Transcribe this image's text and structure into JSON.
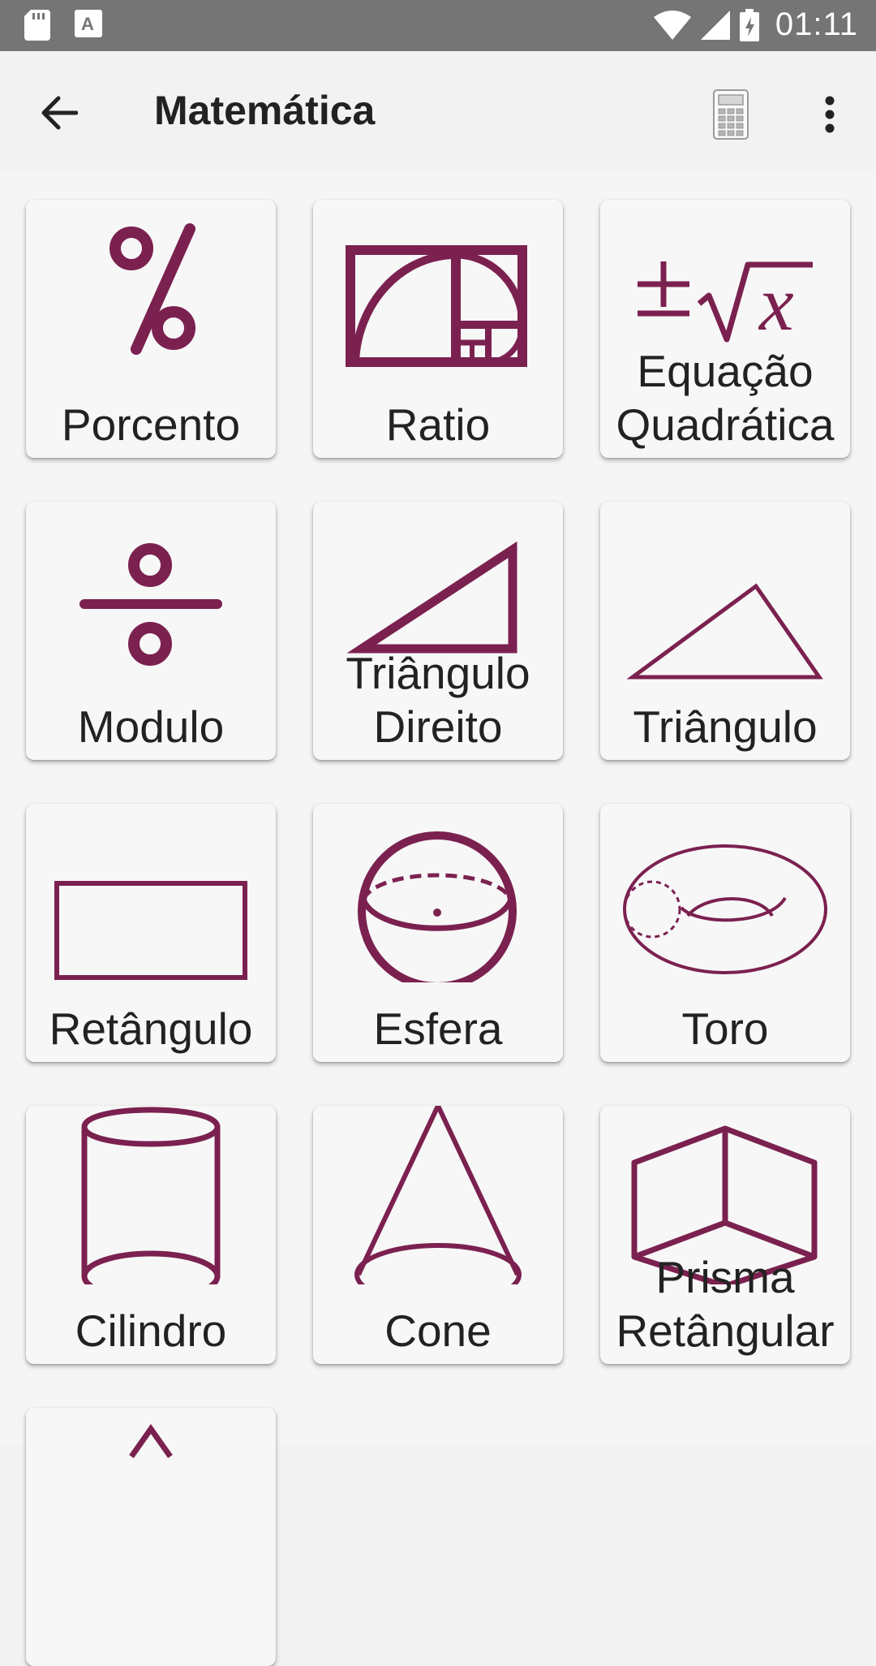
{
  "status_bar": {
    "time": "01:11"
  },
  "app_bar": {
    "title": "Matemática"
  },
  "colors": {
    "accent": "#7b2150",
    "tile_bg": "#f7f7f7"
  },
  "tiles": [
    {
      "lines": [
        "Porcento"
      ],
      "icon": "percent-icon"
    },
    {
      "lines": [
        "Ratio"
      ],
      "icon": "golden-ratio-icon"
    },
    {
      "lines": [
        "Equação",
        "Quadrática"
      ],
      "icon": "quadratic-equation-icon"
    },
    {
      "lines": [
        "Modulo"
      ],
      "icon": "modulo-icon"
    },
    {
      "lines": [
        "Triângulo",
        "Direito"
      ],
      "icon": "right-triangle-icon"
    },
    {
      "lines": [
        "Triângulo"
      ],
      "icon": "triangle-icon"
    },
    {
      "lines": [
        "Retângulo"
      ],
      "icon": "rectangle-icon"
    },
    {
      "lines": [
        "Esfera"
      ],
      "icon": "sphere-icon"
    },
    {
      "lines": [
        "Toro"
      ],
      "icon": "torus-icon"
    },
    {
      "lines": [
        "Cilindro"
      ],
      "icon": "cylinder-icon"
    },
    {
      "lines": [
        "Cone"
      ],
      "icon": "cone-icon"
    },
    {
      "lines": [
        "Prisma",
        "Retângular"
      ],
      "icon": "rectangular-prism-icon"
    },
    {
      "lines": [],
      "icon": "pyramid-icon"
    }
  ]
}
